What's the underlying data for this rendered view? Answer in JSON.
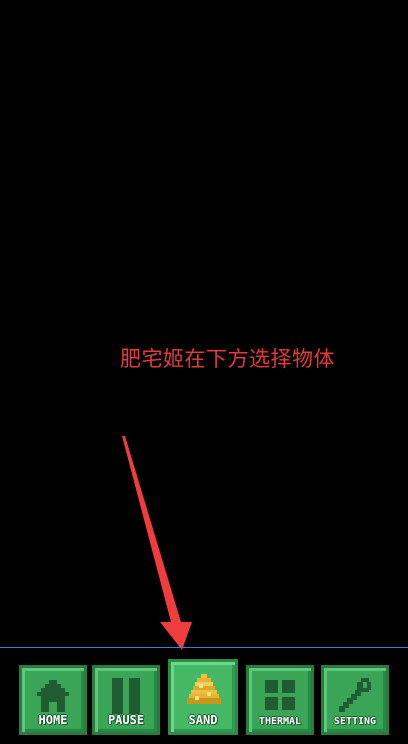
{
  "hint": {
    "text": "肥宅姬在下方选择物体"
  },
  "toolbar": {
    "items": [
      {
        "id": "home",
        "label": "HOME",
        "icon": "house-icon"
      },
      {
        "id": "pause",
        "label": "PAUSE",
        "icon": "pause-icon"
      },
      {
        "id": "sand",
        "label": "SAND",
        "icon": "sand-pile-icon",
        "selected": true
      },
      {
        "id": "thermal",
        "label": "THERMAL",
        "icon": "grid-icon"
      },
      {
        "id": "setting",
        "label": "SETTING",
        "icon": "wrench-icon"
      }
    ]
  },
  "colors": {
    "background": "#000000",
    "hint_text": "#e33a3a",
    "arrow": "#f03c3c",
    "button": "#3aa556",
    "button_dark": "#1f5c32",
    "divider": "#3a7fd0"
  }
}
